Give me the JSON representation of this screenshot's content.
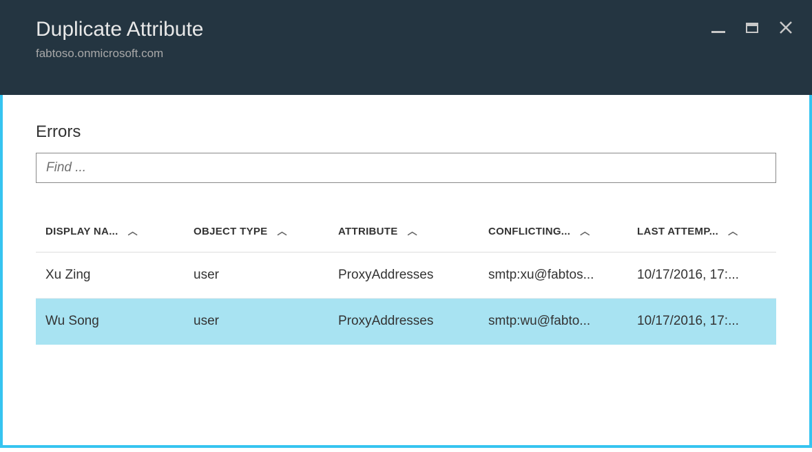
{
  "header": {
    "title": "Duplicate Attribute",
    "subtitle": "fabtoso.onmicrosoft.com"
  },
  "section": {
    "title": "Errors"
  },
  "search": {
    "placeholder": "Find ..."
  },
  "table": {
    "columns": {
      "display_name": "DISPLAY NA...",
      "object_type": "OBJECT TYPE",
      "attribute": "ATTRIBUTE",
      "conflicting": "CONFLICTING...",
      "last_attempt": "LAST ATTEMP..."
    },
    "rows": [
      {
        "display_name": "Xu Zing",
        "object_type": "user",
        "attribute": "ProxyAddresses",
        "conflicting": "smtp:xu@fabtos...",
        "last_attempt": "10/17/2016, 17:..."
      },
      {
        "display_name": "Wu Song",
        "object_type": "user",
        "attribute": "ProxyAddresses",
        "conflicting": "smtp:wu@fabto...",
        "last_attempt": "10/17/2016, 17:..."
      }
    ]
  }
}
